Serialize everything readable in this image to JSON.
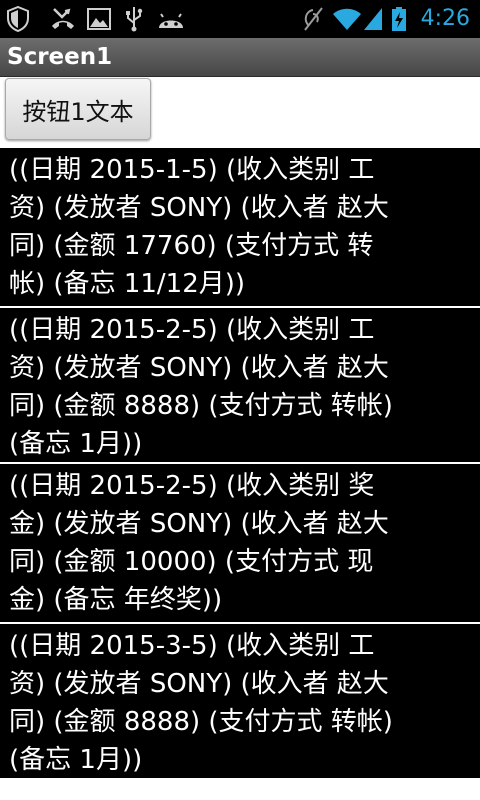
{
  "status_bar": {
    "time": "4:26",
    "icons": [
      "shield-icon",
      "missed-call-icon",
      "image-icon",
      "usb-icon",
      "android-debug-icon",
      "vibrate-off-icon",
      "wifi-icon",
      "signal-icon",
      "battery-charging-icon"
    ],
    "time_color": "#2aa9e0"
  },
  "title_bar": {
    "title": "Screen1"
  },
  "button": {
    "label": "按钮1文本"
  },
  "list": {
    "items": [
      "((日期 2015-1-5) (收入类别 工\n资) (发放者 SONY) (收入者 赵大\n同) (金额 17760) (支付方式 转\n帐) (备忘 11/12月))",
      "((日期 2015-2-5) (收入类别 工\n资) (发放者 SONY) (收入者 赵大\n同) (金额 8888) (支付方式 转帐)\n(备忘 1月))",
      "((日期 2015-2-5) (收入类别 奖\n金) (发放者 SONY) (收入者 赵大\n同) (金额 10000) (支付方式 现\n金) (备忘 年终奖))",
      "((日期 2015-3-5) (收入类别 工\n资) (发放者 SONY) (收入者 赵大\n同) (金额 8888) (支付方式 转帐)\n(备忘 1月))"
    ]
  }
}
